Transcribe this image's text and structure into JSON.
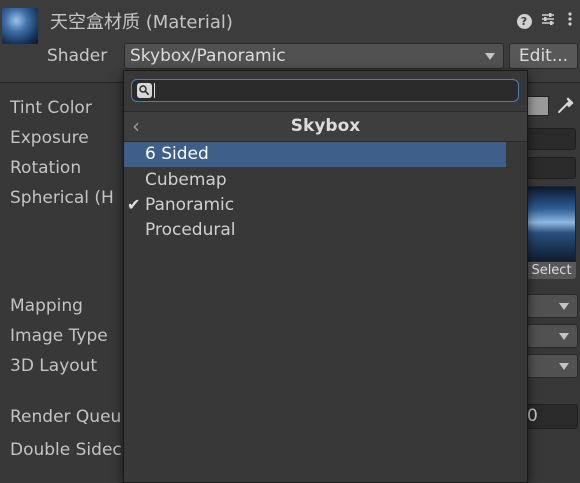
{
  "header": {
    "title": "天空盒材质 (Material)",
    "shader_label": "Shader",
    "shader_value": "Skybox/Panoramic",
    "edit_label": "Edit..."
  },
  "properties": {
    "tint_color": "Tint Color",
    "exposure": "Exposure",
    "rotation": "Rotation",
    "spherical": "Spherical  (H",
    "mapping": "Mapping",
    "image_type": "Image Type",
    "layout_3d": "3D Layout",
    "render_queue": "Render Queu",
    "double_sided": "Double Sidec",
    "render_queue_value": "0",
    "select_label": "Select"
  },
  "popup": {
    "search_placeholder": "",
    "title": "Skybox",
    "items": [
      {
        "label": "6 Sided",
        "highlighted": true,
        "checked": false
      },
      {
        "label": "Cubemap",
        "highlighted": false,
        "checked": false
      },
      {
        "label": "Panoramic",
        "highlighted": false,
        "checked": true
      },
      {
        "label": "Procedural",
        "highlighted": false,
        "checked": false
      }
    ],
    "check_glyph": "✔"
  },
  "icons": {
    "help": "help-icon",
    "preset": "preset-icon",
    "more": "more-icon",
    "eyedropper": "eyedropper-icon",
    "back": "back-arrow-icon",
    "search": "search-icon"
  },
  "colors": {
    "background": "#383838",
    "selection": "#3e5f8a",
    "search_focus": "#4a7fb5"
  }
}
